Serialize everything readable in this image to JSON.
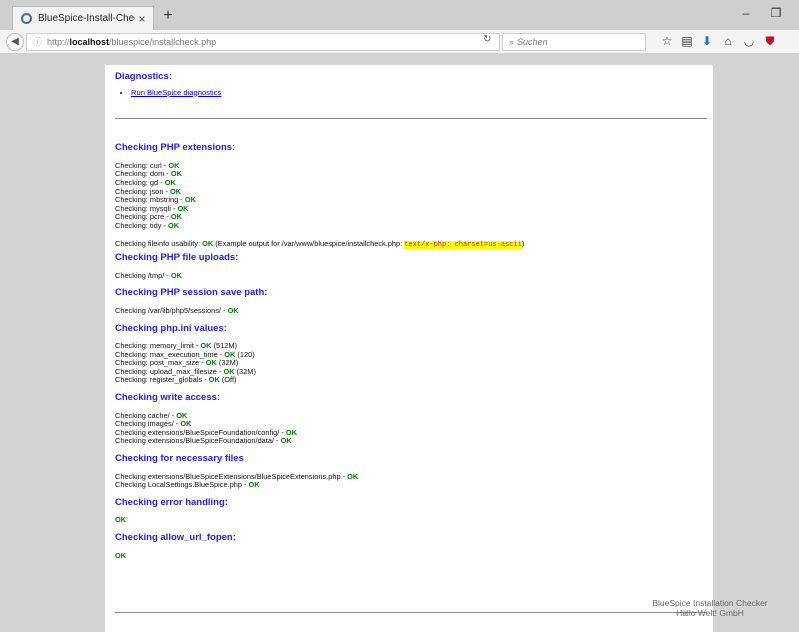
{
  "browser": {
    "tab_title": "BlueSpice-Install-Check",
    "tab_close": "×",
    "new_tab": "+",
    "url_prefix": "http://",
    "url_host": "localhost",
    "url_path": "/bluespice/installcheck.php",
    "search_placeholder": "Suchen"
  },
  "diagnostics": {
    "title": "Diagnostics:",
    "link": "Run BlueSpice diagnostics"
  },
  "ok": "OK",
  "php_extensions": {
    "title": "Checking PHP extensions:",
    "items": [
      "Checking: curl - ",
      "Checking: dom - ",
      "Checking: gd - ",
      "Checking: json - ",
      "Checking: mbstring - ",
      "Checking: mysqli - ",
      "Checking: pcre - ",
      "Checking: tidy - "
    ],
    "fileinfo_prefix": "Checking fileinfo usability: ",
    "fileinfo_mid": " (Example output for /var/www/bluespice/installcheck.php: ",
    "fileinfo_mime": "text/x-php; charset=us-ascii",
    "fileinfo_suffix": ")"
  },
  "file_uploads": {
    "title": "Checking PHP file uploads:",
    "line": "Checking /tmp/ - "
  },
  "session_path": {
    "title": "Checking PHP session save path:",
    "line": "Checking /var/lib/php5/sessions/ - "
  },
  "phpini": {
    "title": "Checking php.ini values:",
    "items": [
      {
        "label": "Checking: memory_limit - ",
        "value": " (512M)"
      },
      {
        "label": "Checking: max_execution_time - ",
        "value": " (120)"
      },
      {
        "label": "Checking: post_max_size - ",
        "value": " (32M)"
      },
      {
        "label": "Checking: upload_max_filesize - ",
        "value": " (32M)"
      },
      {
        "label": "Checking: register_globals - ",
        "value": " (Off)"
      }
    ]
  },
  "write_access": {
    "title": "Checking write access:",
    "items": [
      "Checking cache/ - ",
      "Checking images/ - ",
      "Checking extensions/BlueSpiceFoundation/config/ - ",
      "Checking extensions/BlueSpiceFoundation/data/ - "
    ]
  },
  "necessary_files": {
    "title": "Checking for necessary files",
    "items": [
      "Checking extensions/BlueSpiceExtensions/BlueSpiceExtensions.php - ",
      "Checking LocalSettings.BlueSpice.php - "
    ]
  },
  "error_handling": {
    "title": "Checking error handling:"
  },
  "allow_url_fopen": {
    "title": "Checking allow_url_fopen:"
  },
  "footer": {
    "line1": "BlueSpice Installation Checker",
    "line2": "Hallo Welt! GmbH"
  }
}
